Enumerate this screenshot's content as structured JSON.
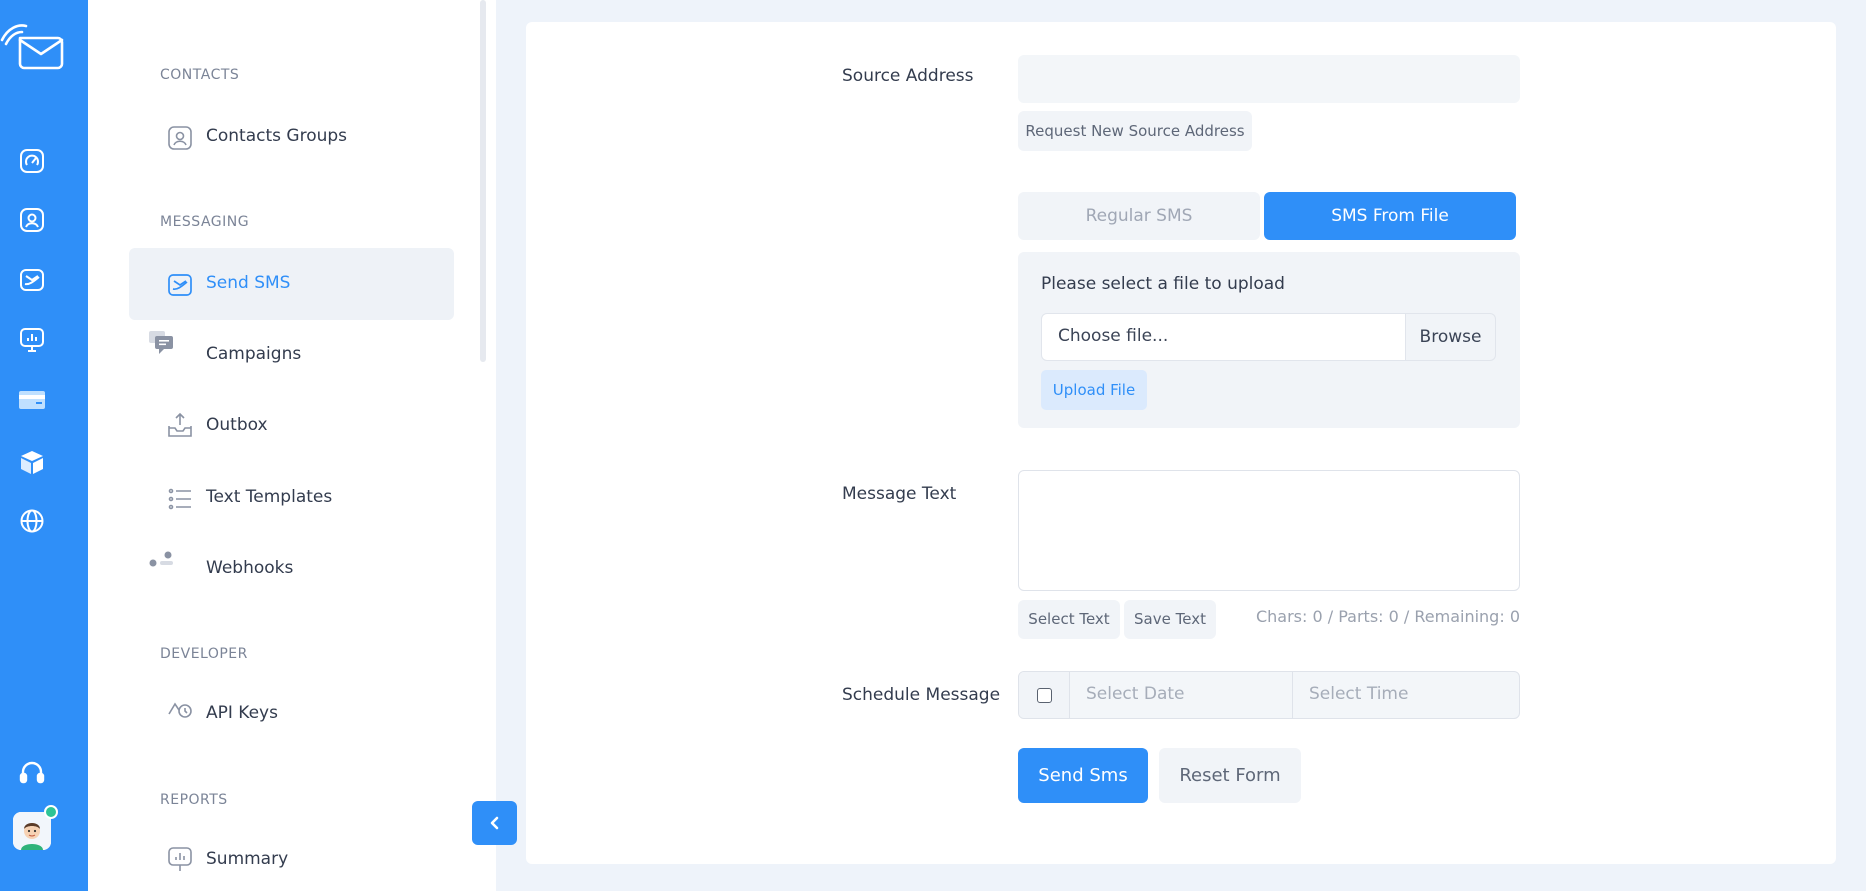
{
  "rail": {
    "icons": [
      "dashboard-icon",
      "contacts-icon",
      "messaging-icon",
      "reports-icon",
      "billing-icon",
      "products-icon",
      "globe-icon"
    ],
    "bottom_icons": [
      "support-headset-icon",
      "user-avatar"
    ]
  },
  "sidebar": {
    "sections": [
      {
        "title": "CONTACTS",
        "items": [
          {
            "label": "Contacts Groups",
            "icon": "contact-card-icon"
          }
        ]
      },
      {
        "title": "MESSAGING",
        "items": [
          {
            "label": "Send SMS",
            "icon": "send-sms-icon",
            "active": true
          },
          {
            "label": "Campaigns",
            "icon": "chat-bubbles-icon"
          },
          {
            "label": "Outbox",
            "icon": "outbox-upload-icon"
          },
          {
            "label": "Text Templates",
            "icon": "list-icon"
          },
          {
            "label": "Webhooks",
            "icon": "webhooks-icon"
          }
        ]
      },
      {
        "title": "DEVELOPER",
        "items": [
          {
            "label": "API Keys",
            "icon": "key-icon"
          }
        ]
      },
      {
        "title": "REPORTS",
        "items": [
          {
            "label": "Summary",
            "icon": "report-chart-icon"
          }
        ]
      }
    ]
  },
  "form": {
    "source_address": {
      "label": "Source Address",
      "value": "",
      "request_button": "Request New Source Address"
    },
    "tabs": [
      {
        "label": "Regular SMS",
        "active": false
      },
      {
        "label": "SMS From File",
        "active": true
      }
    ],
    "upload": {
      "title": "Please select a file to upload",
      "file_placeholder": "Choose file...",
      "browse_label": "Browse",
      "upload_button": "Upload File"
    },
    "message": {
      "label": "Message Text",
      "value": "",
      "select_text": "Select Text",
      "save_text": "Save Text",
      "counter": "Chars: 0 / Parts: 0 / Remaining: 0"
    },
    "schedule": {
      "label": "Schedule Message",
      "checked": false,
      "date_placeholder": "Select Date",
      "time_placeholder": "Select Time"
    },
    "actions": {
      "send": "Send Sms",
      "reset": "Reset Form"
    }
  },
  "colors": {
    "primary": "#2f8ff8",
    "rail": "#2f8ff8",
    "page_bg": "#eef3fa",
    "active_item_bg": "#eef2f7",
    "online": "#2fc495"
  }
}
